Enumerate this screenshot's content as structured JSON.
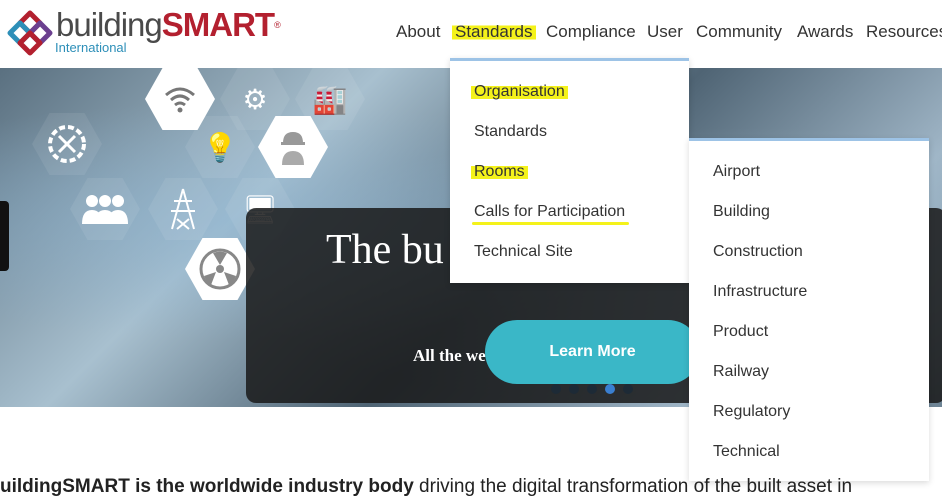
{
  "header": {
    "brand_main": "building",
    "brand_accent": "SMART",
    "brand_reg": "®",
    "brand_sub": "International",
    "nav": [
      "About",
      "Standards",
      "Compliance",
      "User",
      "Community",
      "Awards",
      "Resources"
    ]
  },
  "hero": {
    "title": "The bu",
    "subtitle": "All the webinars are available on",
    "button": "Learn More",
    "slide_count": 5,
    "active_slide": 4
  },
  "standards_menu": {
    "items": [
      "Organisation",
      "Standards",
      "Rooms",
      "Calls for Participation",
      "Technical Site"
    ]
  },
  "rooms_menu": {
    "items": [
      "Airport",
      "Building",
      "Construction",
      "Infrastructure",
      "Product",
      "Railway",
      "Regulatory",
      "Technical"
    ]
  },
  "body": {
    "bold": "uildingSMART is the worldwide industry body",
    "rest": " driving the digital transformation of the built asset in"
  },
  "colors": {
    "accent": "#3ab7c7",
    "brand_red": "#b3202f",
    "highlight": "#f4f21a"
  }
}
